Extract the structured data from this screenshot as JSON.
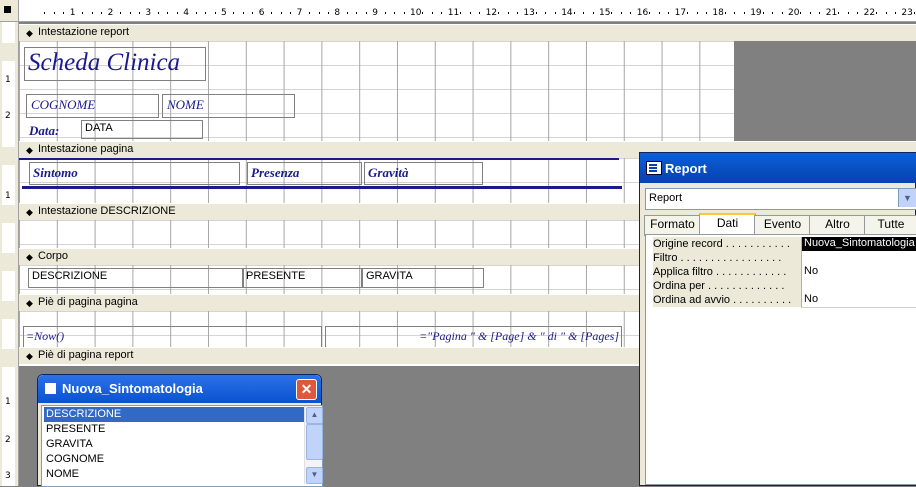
{
  "rulers": {
    "horizontal_ticks": [
      "1",
      "2",
      "3",
      "4",
      "5",
      "6",
      "7",
      "8",
      "9",
      "10",
      "11",
      "12",
      "13",
      "14",
      "15",
      "16",
      "17",
      "18",
      "19",
      "20",
      "21",
      "22",
      "23"
    ],
    "vertical_ticks": [
      "1",
      "2",
      "1",
      "1",
      "2",
      "1",
      "2",
      "3"
    ]
  },
  "sections": {
    "report_header": "Intestazione report",
    "page_header": "Intestazione pagina",
    "group_header": "Intestazione DESCRIZIONE",
    "detail": "Corpo",
    "page_footer": "Piè di pagina pagina",
    "report_footer": "Piè di pagina report"
  },
  "controls": {
    "title": "Scheda Clinica",
    "cognome_label": "COGNOME",
    "nome_label": "NOME",
    "data_label": "Data:",
    "data_field": "DATA",
    "sintomo_label": "Sintomo",
    "presenza_label": "Presenza",
    "gravita_label": "Gravità",
    "descrizione_field": "DESCRIZIONE",
    "presente_field": "PRESENTE",
    "gravita_field": "GRAVITA",
    "now_field": "=Now()",
    "pages_field": "=\"Pagina \" & [Page] & \" di \" & [Pages]"
  },
  "properties": {
    "title": "Report",
    "selector_value": "Report",
    "tabs": [
      "Formato",
      "Dati",
      "Evento",
      "Altro",
      "Tutte"
    ],
    "active_tab": "Dati",
    "rows": [
      {
        "name": "Origine record . . . . . . . . . . .",
        "value": "Nuova_Sintomatologia"
      },
      {
        "name": "Filtro . . . . . . . . . . . . . . . . .",
        "value": ""
      },
      {
        "name": "Applica filtro . . . . . . . . . . . .",
        "value": "No"
      },
      {
        "name": "Ordina per . . . . . . . . . . . . .",
        "value": ""
      },
      {
        "name": "Ordina ad avvio . . . . . . . . . .",
        "value": "No"
      }
    ]
  },
  "field_list": {
    "title": "Nuova_Sintomatologia",
    "close_glyph": "✕",
    "items": [
      "DESCRIZIONE",
      "PRESENTE",
      "GRAVITA",
      "COGNOME",
      "NOME"
    ]
  }
}
